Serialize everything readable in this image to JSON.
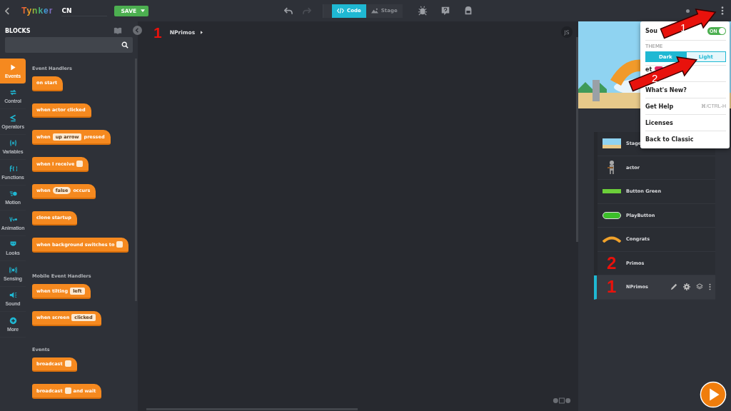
{
  "topbar": {
    "project_name": "CN",
    "save_label": "SAVE",
    "logo": "Tynker",
    "tabs": [
      {
        "label": "Code",
        "selected": true
      },
      {
        "label": "Stage",
        "selected": false
      }
    ]
  },
  "blocks_panel": {
    "title": "BLOCKS",
    "categories": [
      {
        "label": "Events",
        "selected": true
      },
      {
        "label": "Control",
        "selected": false
      },
      {
        "label": "Operators",
        "selected": false
      },
      {
        "label": "Variables",
        "selected": false
      },
      {
        "label": "Functions",
        "selected": false
      },
      {
        "label": "Motion",
        "selected": false
      },
      {
        "label": "Animation",
        "selected": false
      },
      {
        "label": "Looks",
        "selected": false
      },
      {
        "label": "Sensing",
        "selected": false
      },
      {
        "label": "Sound",
        "selected": false
      },
      {
        "label": "More",
        "selected": false
      }
    ],
    "sections": [
      {
        "title": "Event Handlers",
        "blocks": [
          {
            "parts": [
              {
                "kind": "text",
                "text": "on start"
              }
            ]
          },
          {
            "parts": [
              {
                "kind": "text",
                "text": "when actor clicked"
              }
            ]
          },
          {
            "parts": [
              {
                "kind": "text",
                "text": "when"
              },
              {
                "kind": "slot",
                "text": "up arrow"
              },
              {
                "kind": "text",
                "text": "pressed"
              }
            ]
          },
          {
            "parts": [
              {
                "kind": "text",
                "text": "when I receive"
              },
              {
                "kind": "blank"
              }
            ]
          },
          {
            "parts": [
              {
                "kind": "text",
                "text": "when"
              },
              {
                "kind": "bool",
                "text": "false"
              },
              {
                "kind": "text",
                "text": "occurs"
              }
            ]
          },
          {
            "parts": [
              {
                "kind": "text",
                "text": "clone startup"
              }
            ]
          },
          {
            "parts": [
              {
                "kind": "text",
                "text": "when background switches to"
              },
              {
                "kind": "blank"
              }
            ]
          }
        ]
      },
      {
        "title": "Mobile Event Handlers",
        "blocks": [
          {
            "parts": [
              {
                "kind": "text",
                "text": "when tilting"
              },
              {
                "kind": "slot",
                "text": "left"
              }
            ]
          },
          {
            "parts": [
              {
                "kind": "text",
                "text": "when screen"
              },
              {
                "kind": "slot",
                "text": "clicked"
              }
            ]
          }
        ]
      },
      {
        "title": "Events",
        "blocks": [
          {
            "parts": [
              {
                "kind": "text",
                "text": "broadcast"
              },
              {
                "kind": "blank"
              }
            ]
          },
          {
            "parts": [
              {
                "kind": "text",
                "text": "broadcast"
              },
              {
                "kind": "blank"
              },
              {
                "kind": "text",
                "text": "and wait"
              }
            ]
          }
        ]
      }
    ]
  },
  "canvas": {
    "marker": "1",
    "breadcrumb": "NPrimos",
    "js_label": "JS"
  },
  "actors": [
    {
      "name": "Stage",
      "kind": "stage",
      "selected": false
    },
    {
      "name": "actor",
      "kind": "knight",
      "selected": false
    },
    {
      "name": "Button Green",
      "kind": "bar",
      "selected": false
    },
    {
      "name": "PlayButton",
      "kind": "pill",
      "selected": false
    },
    {
      "name": "Congrats",
      "kind": "arc",
      "selected": false
    },
    {
      "name": "Primos",
      "kind": "marked",
      "marker": "2",
      "selected": false
    },
    {
      "name": "NPrimos",
      "kind": "marked",
      "marker": "1",
      "selected": true
    }
  ],
  "menu": {
    "sound_label": "Sou",
    "sound_on": true,
    "sound_toggle_label": "ON",
    "theme_label": "THEME",
    "themes": [
      {
        "label": "Dark",
        "selected": true
      },
      {
        "label": "Light",
        "selected": false
      }
    ],
    "items": [
      {
        "label": "et",
        "badge": true
      },
      {
        "label": "What's New?",
        "badge": false
      },
      {
        "label": "Get Help",
        "badge": false,
        "shortcut": "⌘/CTRL-H"
      },
      {
        "label": "Licenses",
        "badge": false
      },
      {
        "label": "Back to Classic",
        "badge": false
      }
    ]
  },
  "annotations": [
    {
      "number": "1"
    },
    {
      "number": "2"
    }
  ]
}
